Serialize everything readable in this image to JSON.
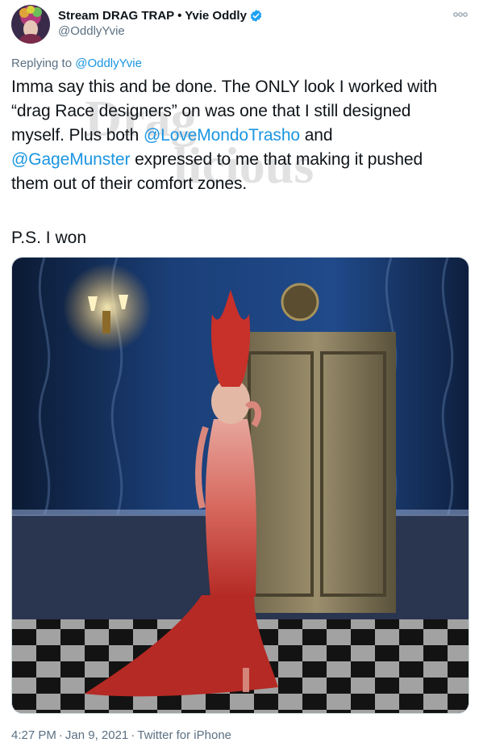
{
  "author": {
    "display_name": "Stream DRAG TRAP • Yvie Oddly",
    "handle": "@OddlyYvie",
    "verified": true
  },
  "replying": {
    "prefix": "Replying to ",
    "mention": "@OddlyYvie"
  },
  "tweet": {
    "line1": "Imma say this and be done. The ONLY look I worked with",
    "line2": "“drag Race designers” on was one that I still designed",
    "line3_prefix": "myself. Plus both ",
    "mention1": "@LoveMondoTrasho",
    "line3_suffix": " and",
    "mention2": "@GageMunster",
    "line4_suffix": " expressed to me that making it pushed",
    "line5": "them out of their comfort zones.",
    "ps": "P.S. I won"
  },
  "watermark": {
    "text_top": "Drag",
    "text_bottom": "licious"
  },
  "meta": {
    "time": "4:27 PM",
    "date": "Jan 9, 2021",
    "source": "Twitter for iPhone",
    "separator": "·"
  },
  "icons": {
    "verified": "verified-badge-icon",
    "more": "more-options-icon"
  },
  "colors": {
    "link": "#1b95e0",
    "secondary_text": "#5b7083",
    "verified": "#1da1f2"
  }
}
